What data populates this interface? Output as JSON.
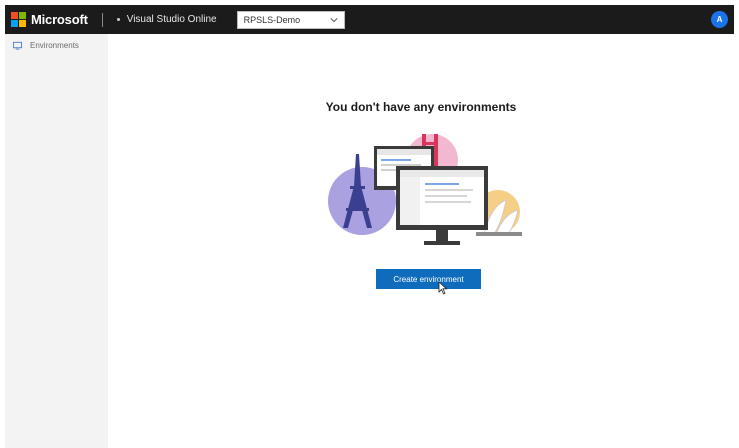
{
  "header": {
    "brand": "Microsoft",
    "product": "Visual Studio Online",
    "plan_selected": "RPSLS-Demo",
    "avatar_initial": "A",
    "colors": {
      "bar": "#1b1b1b",
      "avatar": "#1a73e8",
      "logo": [
        "#f25022",
        "#7fba00",
        "#00a4ef",
        "#ffb900"
      ]
    }
  },
  "sidebar": {
    "items": [
      {
        "label": "Environments",
        "icon": "environments-icon"
      }
    ]
  },
  "main": {
    "empty_title": "You don't have any environments",
    "create_button_label": "Create environment",
    "illustration": "environments-empty-illustration",
    "accent": "#0f6cbd"
  }
}
